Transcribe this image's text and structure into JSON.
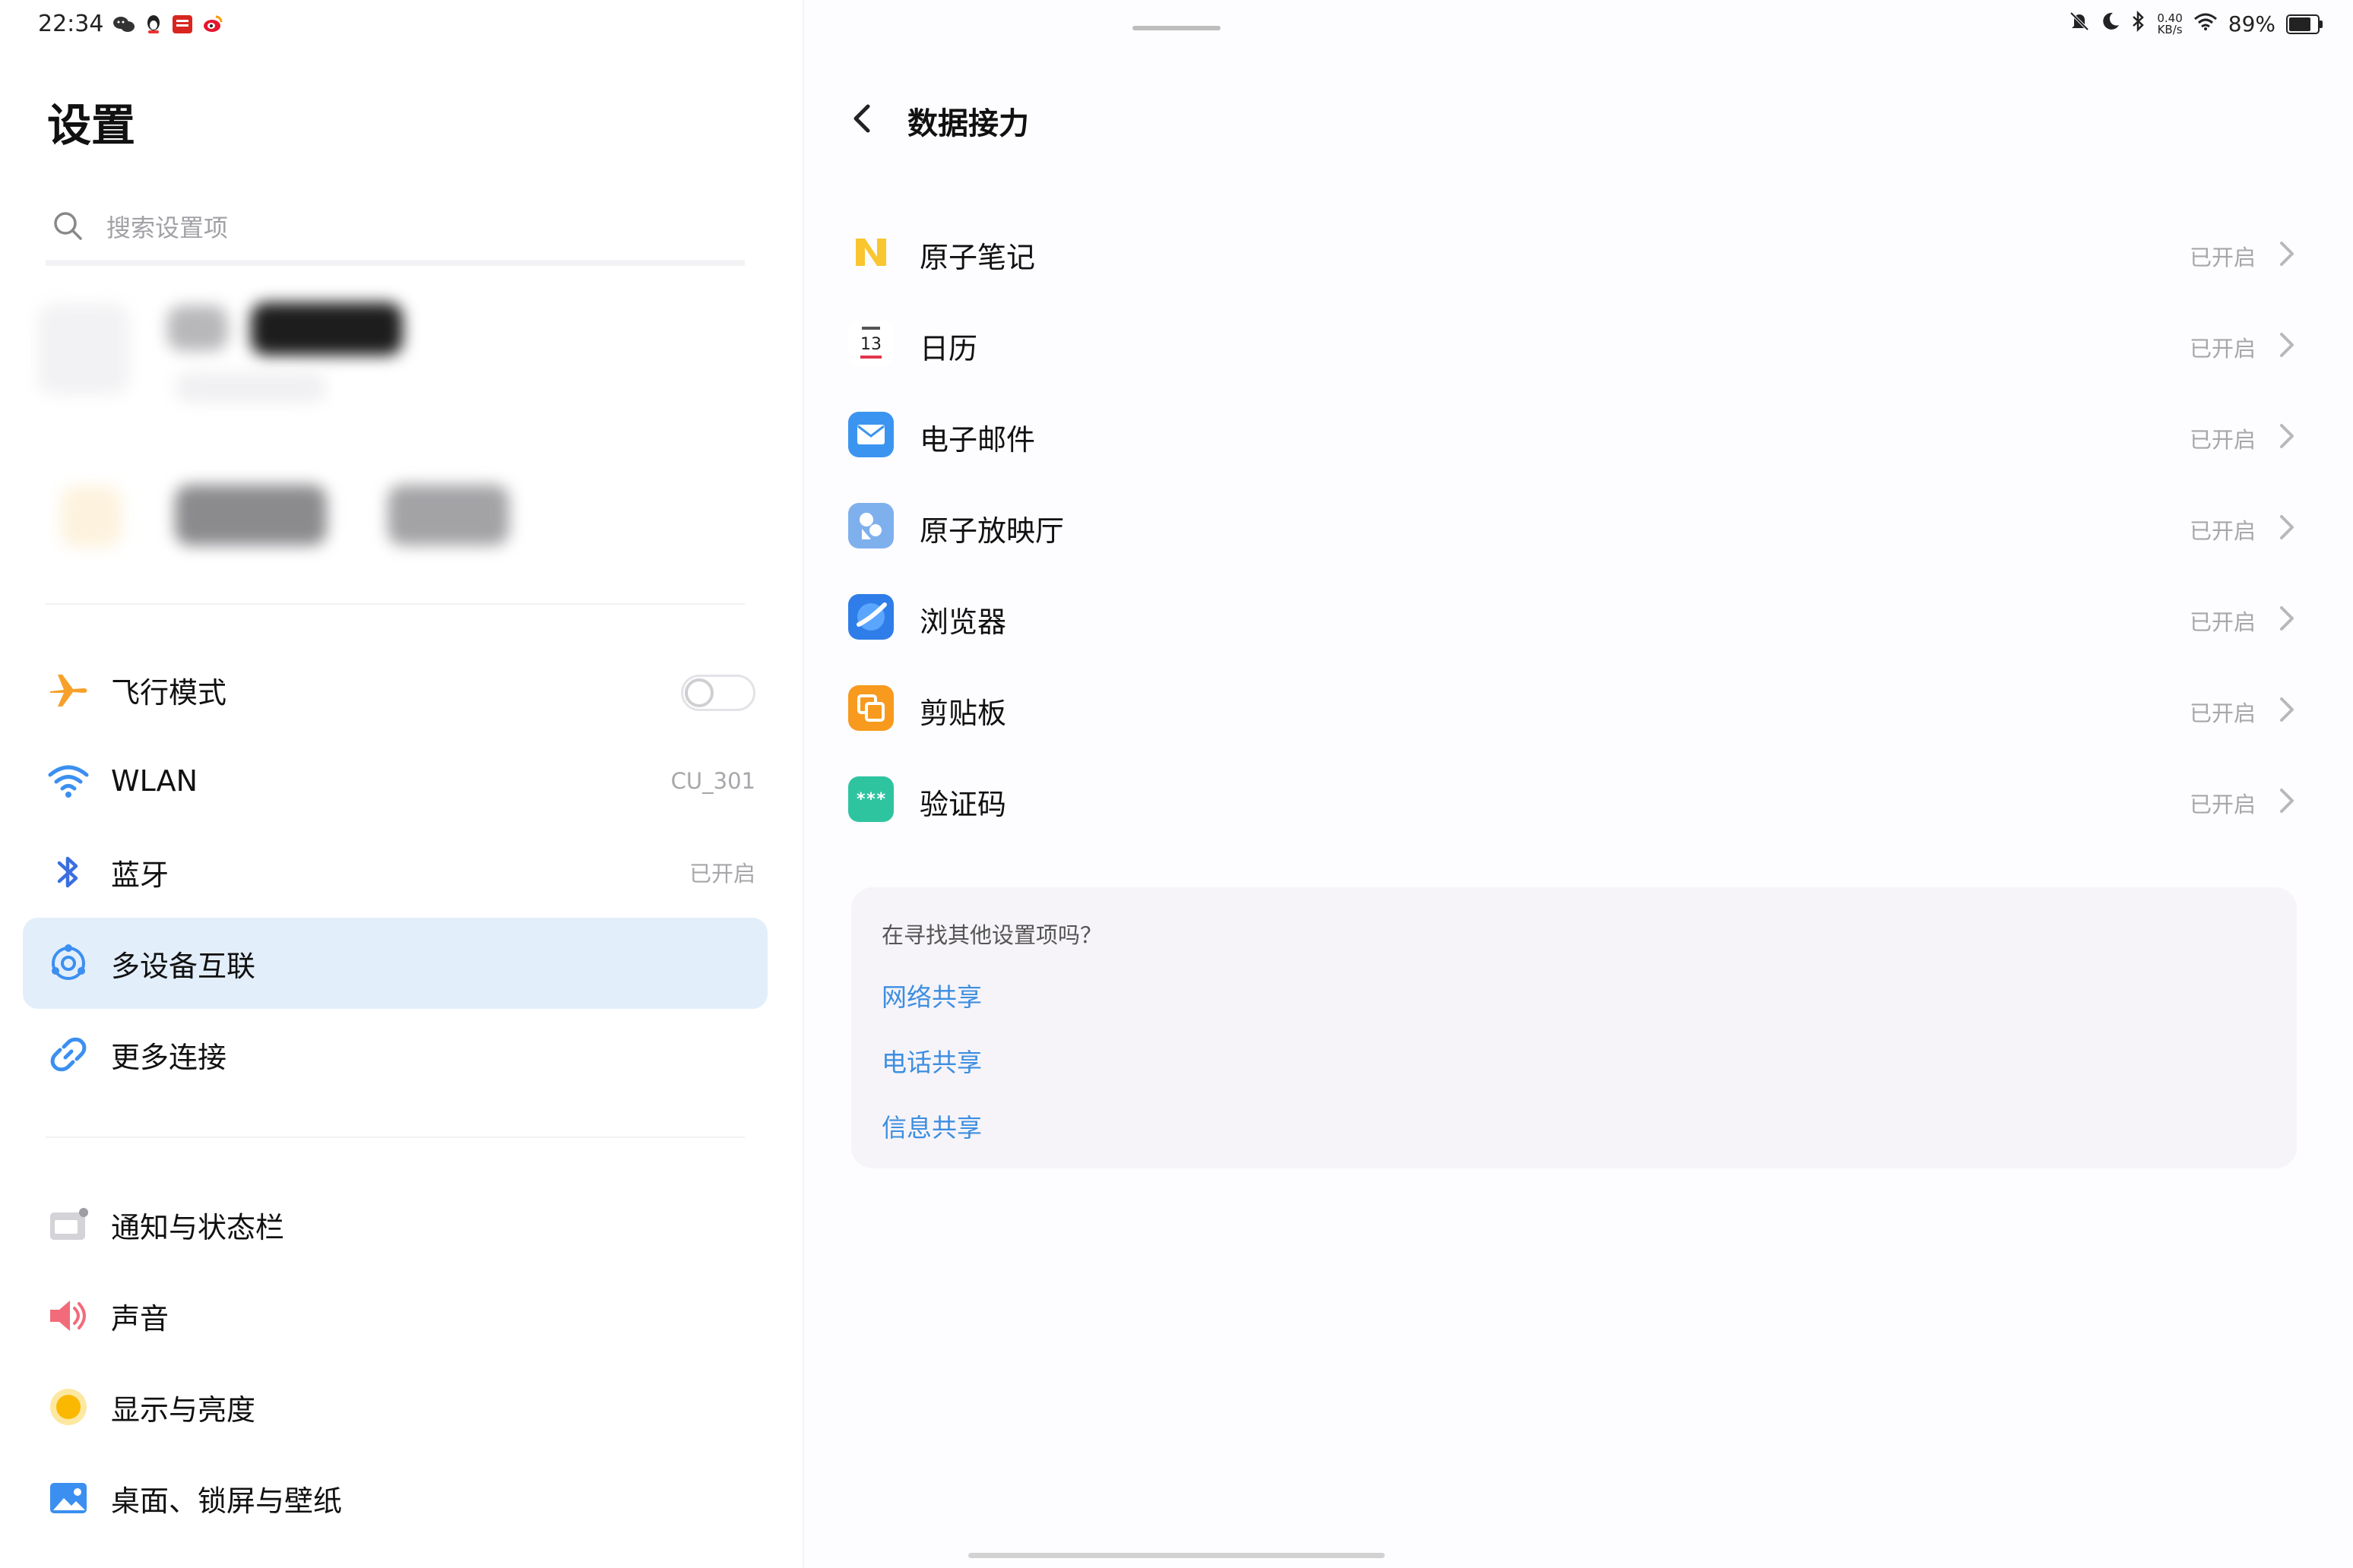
{
  "status_bar": {
    "time": "22:34",
    "notification_icons": [
      "wechat-icon",
      "qq-icon",
      "news-app-icon",
      "weibo-icon"
    ],
    "net_speed_value": "0.40",
    "net_speed_unit": "KB/s",
    "battery_percent": "89%",
    "battery_level": 0.89,
    "icons": [
      "mute-icon",
      "do-not-disturb-icon",
      "bluetooth-icon",
      "wifi-icon",
      "battery-icon"
    ]
  },
  "sidebar": {
    "title": "设置",
    "search_placeholder": "搜索设置项",
    "items": [
      {
        "key": "airplane",
        "label": "飞行模式",
        "icon": "airplane-icon",
        "toggle_on": false
      },
      {
        "key": "wlan",
        "label": "WLAN",
        "value": "CU_301",
        "icon": "wifi-icon"
      },
      {
        "key": "bluetooth",
        "label": "蓝牙",
        "value": "已开启",
        "icon": "bluetooth-icon"
      },
      {
        "key": "multidevice",
        "label": "多设备互联",
        "icon": "multi-device-icon",
        "active": true
      },
      {
        "key": "more",
        "label": "更多连接",
        "icon": "link-icon"
      },
      {
        "key": "notifications",
        "label": "通知与状态栏",
        "icon": "notification-icon"
      },
      {
        "key": "sound",
        "label": "声音",
        "icon": "speaker-icon"
      },
      {
        "key": "display",
        "label": "显示与亮度",
        "icon": "brightness-icon"
      },
      {
        "key": "wallpaper",
        "label": "桌面、锁屏与壁纸",
        "icon": "wallpaper-icon"
      }
    ]
  },
  "detail": {
    "title": "数据接力",
    "apps": [
      {
        "label": "原子笔记",
        "status": "已开启",
        "icon": "atom-notes-icon"
      },
      {
        "label": "日历",
        "status": "已开启",
        "icon": "calendar-icon",
        "icon_text": "13"
      },
      {
        "label": "电子邮件",
        "status": "已开启",
        "icon": "email-icon"
      },
      {
        "label": "原子放映厅",
        "status": "已开启",
        "icon": "atom-cinema-icon"
      },
      {
        "label": "浏览器",
        "status": "已开启",
        "icon": "browser-icon"
      },
      {
        "label": "剪贴板",
        "status": "已开启",
        "icon": "clipboard-icon"
      },
      {
        "label": "验证码",
        "status": "已开启",
        "icon": "verification-code-icon",
        "icon_text": "***"
      }
    ],
    "suggestions": {
      "title": "在寻找其他设置项吗？",
      "links": [
        "网络共享",
        "电话共享",
        "信息共享"
      ]
    }
  },
  "colors": {
    "accent": "#3d8ee0",
    "active_bg": "#e3eefb",
    "muted_text": "#a7a7ab"
  }
}
